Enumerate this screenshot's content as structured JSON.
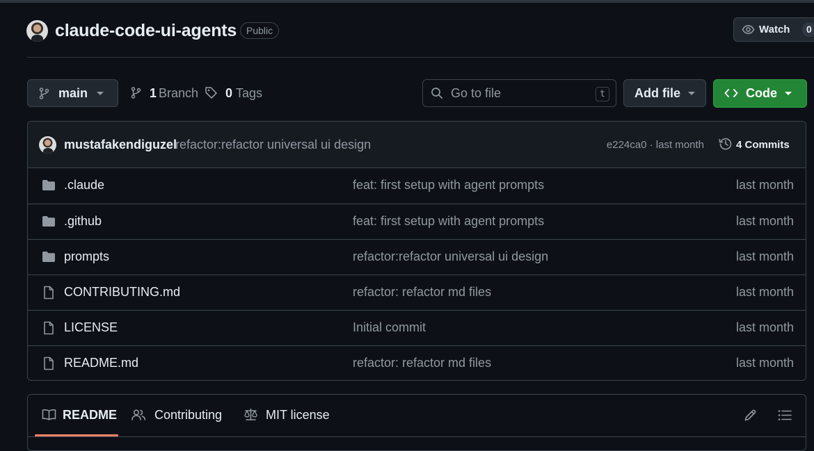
{
  "repo": {
    "name": "claude-code-ui-agents",
    "visibility": "Public",
    "watch_label": "Watch",
    "watch_count": "0"
  },
  "toolbar": {
    "branch": "main",
    "branches_count": "1",
    "branches_label": "Branch",
    "tags_count": "0",
    "tags_label": "Tags",
    "search_placeholder": "Go to file",
    "search_shortcut": "t",
    "add_file_label": "Add file",
    "code_label": "Code"
  },
  "latest_commit": {
    "author": "mustafakendiguzel",
    "message": "refactor:refactor universal ui design",
    "meta": "e224ca0 · last month",
    "commits_label": "4 Commits"
  },
  "files": [
    {
      "name": ".claude",
      "type": "folder",
      "message": "feat: first setup with agent prompts",
      "time": "last month"
    },
    {
      "name": ".github",
      "type": "folder",
      "message": "feat: first setup with agent prompts",
      "time": "last month"
    },
    {
      "name": "prompts",
      "type": "folder",
      "message": "refactor:refactor universal ui design",
      "time": "last month"
    },
    {
      "name": "CONTRIBUTING.md",
      "type": "file",
      "message": "refactor: refactor md files",
      "time": "last month"
    },
    {
      "name": "LICENSE",
      "type": "file",
      "message": "Initial commit",
      "time": "last month"
    },
    {
      "name": "README.md",
      "type": "file",
      "message": "refactor: refactor md files",
      "time": "last month"
    }
  ],
  "readme_tabs": [
    {
      "label": "README",
      "icon": "book-icon",
      "active": true
    },
    {
      "label": "Contributing",
      "icon": "people-icon",
      "active": false
    },
    {
      "label": "MIT license",
      "icon": "scale-icon",
      "active": false
    }
  ],
  "colors": {
    "background": "#0d1117",
    "border": "#3d444d",
    "code_button": "#238636",
    "active_tab_underline": "#f78166"
  }
}
